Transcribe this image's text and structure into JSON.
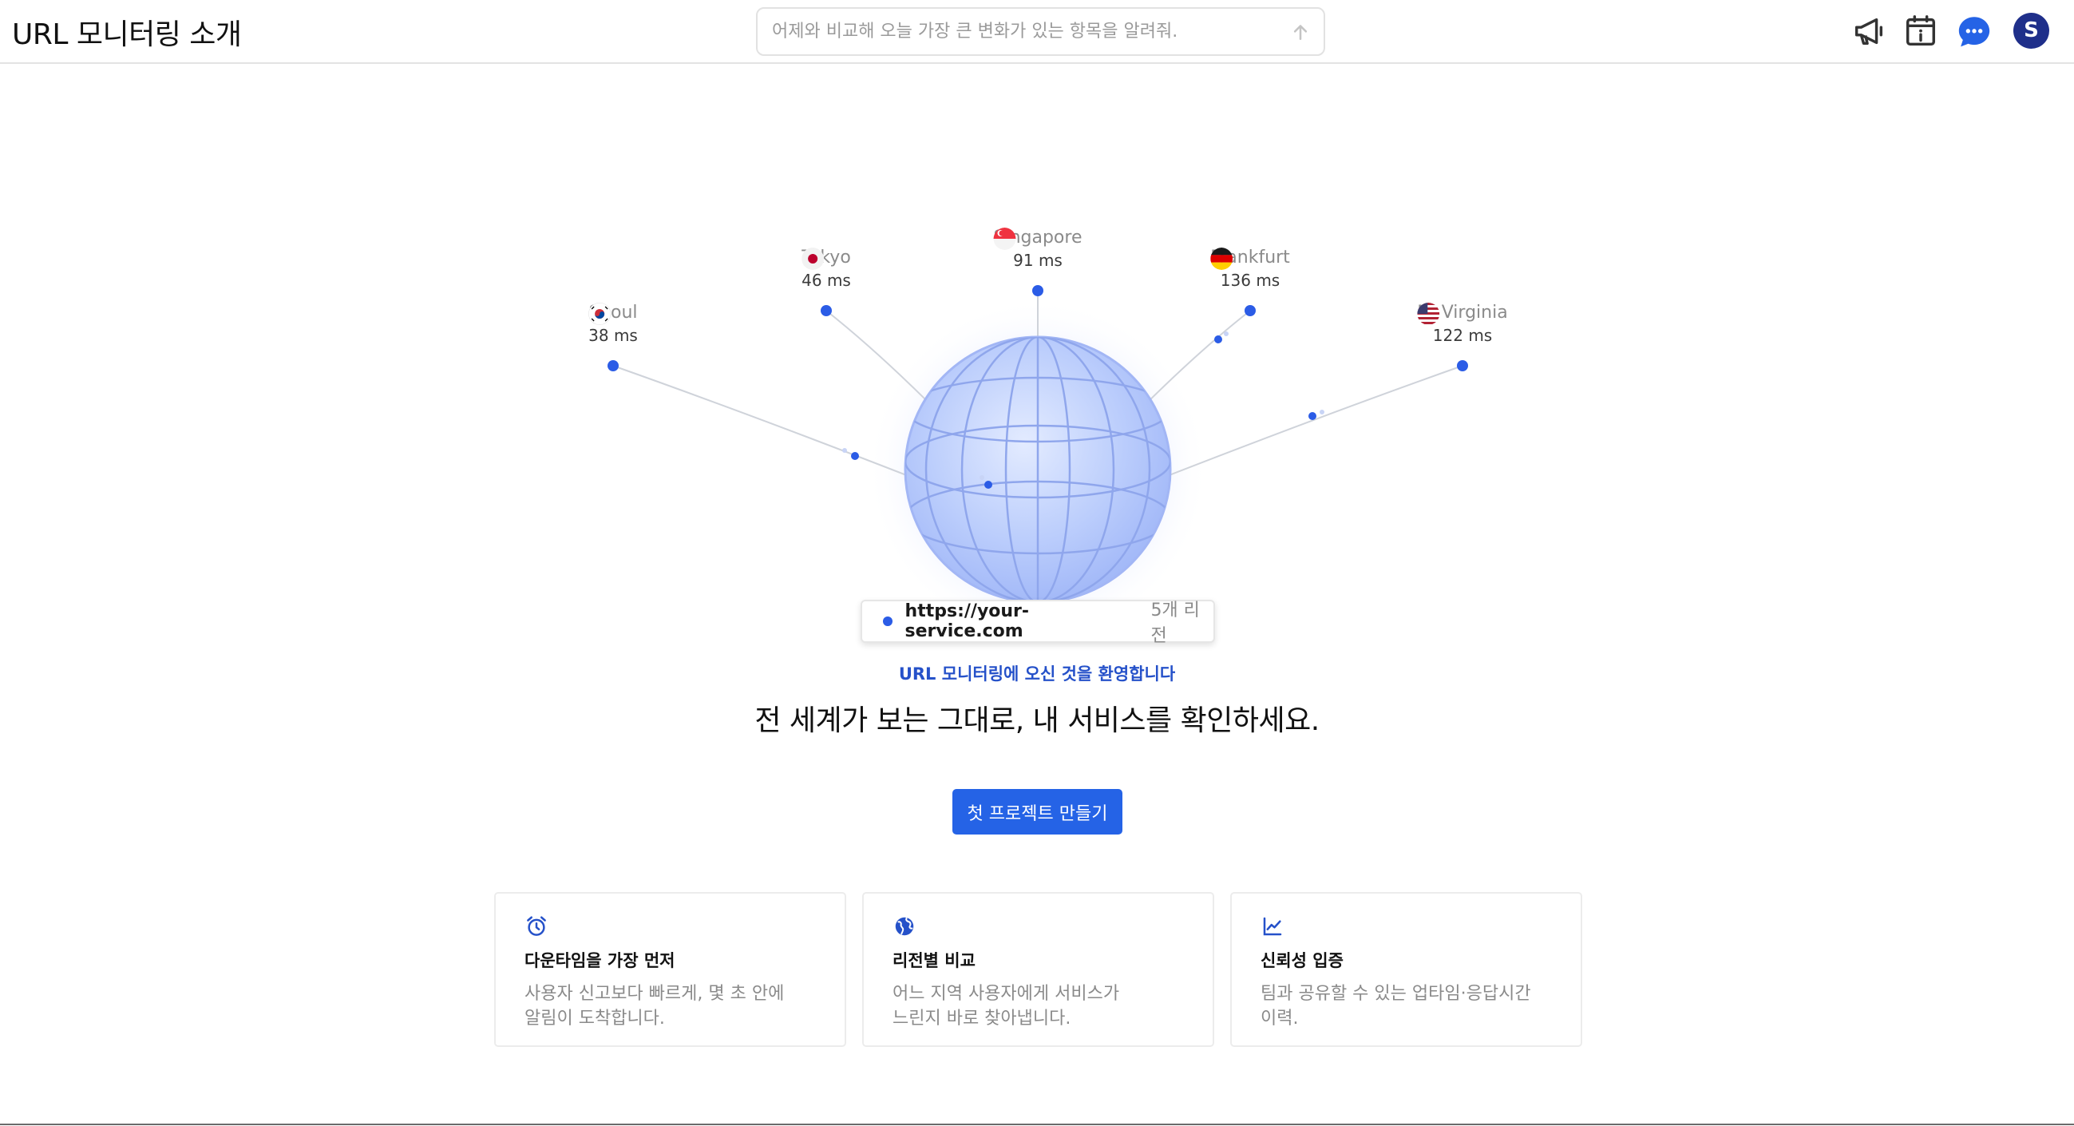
{
  "header": {
    "title": "URL 모니터링 소개",
    "search_placeholder": "어제와 비교해 오늘 가장 큰 변화가 있는 항목을 알려줘.",
    "avatar_initial": "S",
    "icons": [
      "megaphone-icon",
      "calendar-info-icon",
      "chat-bubble-icon",
      "send-arrow-icon"
    ]
  },
  "hero": {
    "regions": [
      {
        "name": "Seoul",
        "latency": "38 ms",
        "flag": "kr"
      },
      {
        "name": "Tokyo",
        "latency": "46 ms",
        "flag": "jp"
      },
      {
        "name": "Singapore",
        "latency": "91 ms",
        "flag": "sg"
      },
      {
        "name": "Frankfurt",
        "latency": "136 ms",
        "flag": "de"
      },
      {
        "name": "N. Virginia",
        "latency": "122 ms",
        "flag": "us"
      }
    ],
    "target_url": "https://your-service.com",
    "region_count": "5개 리전"
  },
  "welcome": {
    "eyebrow": "URL 모니터링에 오신 것을 환영합니다",
    "headline": "전 세계가 보는 그대로, 내 서비스를 확인하세요.",
    "cta_label": "첫 프로젝트 만들기"
  },
  "features": [
    {
      "icon": "alarm-clock-icon",
      "title": "다운타임을 가장 먼저",
      "desc_line1": "사용자 신고보다 빠르게, 몇 초 안에",
      "desc_line2": "알림이 도착합니다."
    },
    {
      "icon": "globe-icon",
      "title": "리전별 비교",
      "desc_line1": "어느 지역 사용자에게 서비스가",
      "desc_line2": "느린지 바로 찾아냅니다."
    },
    {
      "icon": "line-chart-icon",
      "title": "신뢰성 입증",
      "desc_line1": "팀과 공유할 수 있는 업타임·응답시간",
      "desc_line2": "이력."
    }
  ],
  "colors": {
    "accent": "#2563e6",
    "accent_text": "#2551c9",
    "avatar_bg": "#1f2f8a",
    "dot": "#2b5ce6",
    "globe": "#aec4fb"
  }
}
